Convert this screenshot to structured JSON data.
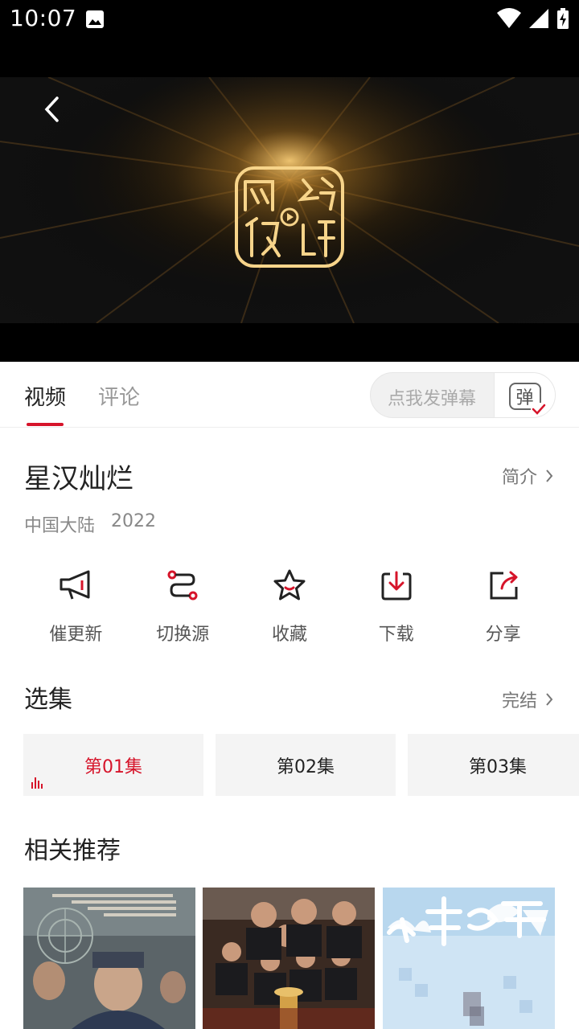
{
  "status_bar": {
    "time": "10:07"
  },
  "tabs": [
    {
      "label": "视频"
    },
    {
      "label": "评论"
    }
  ],
  "danmaku": {
    "placeholder": "点我发弹幕",
    "toggle_label": "弹"
  },
  "show": {
    "title": "星汉灿烂",
    "intro_label": "简介",
    "region": "中国大陆",
    "year": "2022"
  },
  "actions": [
    {
      "label": "催更新",
      "icon": "megaphone-icon"
    },
    {
      "label": "切换源",
      "icon": "switch-source-icon"
    },
    {
      "label": "收藏",
      "icon": "star-icon"
    },
    {
      "label": "下载",
      "icon": "download-icon"
    },
    {
      "label": "分享",
      "icon": "share-icon"
    }
  ],
  "episodes_section": {
    "title": "选集",
    "status_label": "完结",
    "episodes": [
      {
        "label": "第01集",
        "active": true
      },
      {
        "label": "第02集",
        "active": false
      },
      {
        "label": "第03集",
        "active": false
      }
    ]
  },
  "recommend_section": {
    "title": "相关推荐"
  },
  "colors": {
    "accent": "#d6142a",
    "status_bar": "#000000"
  }
}
